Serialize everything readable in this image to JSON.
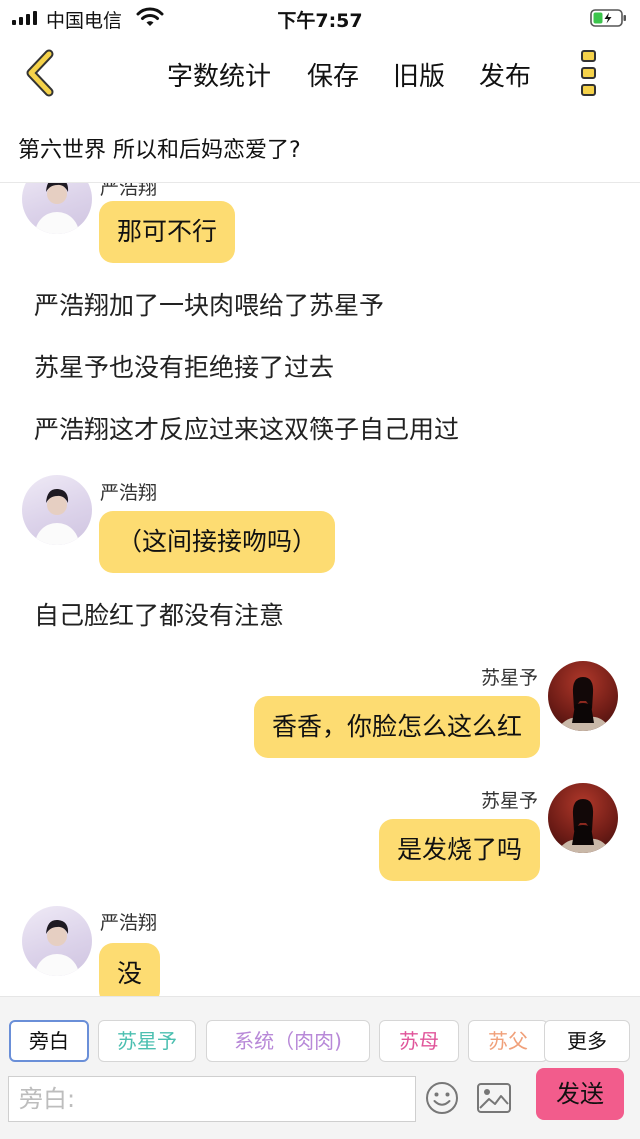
{
  "status_bar": {
    "carrier": "中国电信",
    "time": "下午7:57"
  },
  "header": {
    "actions": [
      "字数统计",
      "保存",
      "旧版",
      "发布"
    ]
  },
  "chapter": {
    "title": "第六世界  所以和后妈恋爱了?"
  },
  "chat": {
    "partial_top": {
      "name": "严浩翔",
      "text": "那可不行"
    },
    "narration_1": [
      "严浩翔加了一块肉喂给了苏星予",
      "苏星予也没有拒绝接了过去",
      "严浩翔这才反应过来这双筷子自己用过"
    ],
    "msg_kiss": {
      "name": "严浩翔",
      "text": "（这间接接吻吗）"
    },
    "narration_2": "自己脸红了都没有注意",
    "msg_xiang": {
      "name": "苏星予",
      "text": "香香，你脸怎么这么红"
    },
    "msg_fever": {
      "name": "苏星予",
      "text": "是发烧了吗"
    },
    "msg_no": {
      "name": "严浩翔",
      "text": "没"
    }
  },
  "toolbar": {
    "roles": [
      {
        "label": "旁白",
        "color": "#111111",
        "active": true
      },
      {
        "label": "苏星予",
        "color": "#4bbfb0",
        "active": false
      },
      {
        "label": "系统（肉肉)",
        "color": "#b889d8",
        "active": false
      },
      {
        "label": "苏母",
        "color": "#e0559a",
        "active": false
      },
      {
        "label": "苏父",
        "color": "#f0a07a",
        "active": false
      },
      {
        "label": "更多",
        "color": "#111111",
        "active": false
      }
    ],
    "input_placeholder": "旁白:",
    "send_label": "发送"
  },
  "colors": {
    "bubble": "#fddc72",
    "send_button": "#f25c8c",
    "active_chip_border": "#6a8fd8",
    "menu_dots": "#f5d24a"
  },
  "icons": [
    "signal-icon",
    "wifi-icon",
    "battery-icon",
    "back-chevron-icon",
    "more-menu-icon",
    "emoji-icon",
    "image-icon"
  ]
}
